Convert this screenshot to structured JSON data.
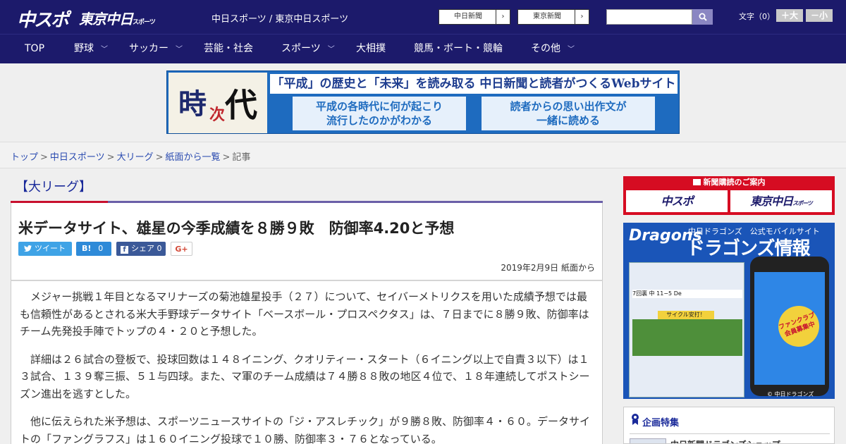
{
  "header": {
    "logo_main": "中スポ",
    "logo_tokyo": "東京中日",
    "logo_tokyo_small": "スポーツ",
    "site_title": "中日スポーツ / 東京中日スポーツ",
    "chunichi_link": "中日新聞",
    "tokyo_link": "東京新聞",
    "arrow": "›",
    "fontsize_label": "文字（0）",
    "font_up": "＋大",
    "font_down": "－小",
    "search_placeholder": ""
  },
  "nav": {
    "items": [
      {
        "label": "TOP",
        "chevron": false
      },
      {
        "label": "野球",
        "chevron": true
      },
      {
        "label": "サッカー",
        "chevron": true
      },
      {
        "label": "芸能・社会",
        "chevron": false
      },
      {
        "label": "スポーツ",
        "chevron": true
      },
      {
        "label": "大相撲",
        "chevron": false
      },
      {
        "label": "競馬・ボート・競輪",
        "chevron": false
      },
      {
        "label": "その他",
        "chevron": true
      }
    ],
    "chevron_glyph": "﹀"
  },
  "banner": {
    "logo_chars": [
      "時",
      "次",
      "代"
    ],
    "headline": "「平成」の歴史と「未来」を読み取る 中日新聞と読者がつくるWebサイト",
    "left_box": [
      "平成の各時代に何が起こり",
      "流行したのかがわかる"
    ],
    "right_box": [
      "読者からの思い出作文が",
      "一緒に読める"
    ],
    "colors": {
      "blue": "#1e6bbf",
      "red": "#c0272d"
    }
  },
  "breadcrumb": {
    "links": [
      "トップ",
      "中日スポーツ",
      "大リーグ",
      "紙面から一覧"
    ],
    "current": "記事",
    "separator": ">"
  },
  "article": {
    "category": "【大リーグ】",
    "title": "米データサイト、雄星の今季成績を８勝９敗　防御率4.20と予想",
    "share": {
      "twitter": "ツイート",
      "hatena": "B!",
      "hatena_count": "0",
      "facebook": "シェア",
      "facebook_count": "0",
      "gplus": "G+"
    },
    "date": "2019年2月9日 紙面から",
    "paragraphs": [
      "メジャー挑戦１年目となるマリナーズの菊池雄星投手（２７）について、セイバーメトリクスを用いた成績予想では最も信頼性があるとされる米大手野球データサイト「ベースボール・プロスペクタス」は、７日までに８勝９敗、防御率はチーム先発投手陣でトップの４・２０と予想した。",
      "詳細は２６試合の登板で、投球回数は１４８イニング、クオリティー・スタート（６イニング以上で自責３以下）は１３試合、１３９奪三振、５１与四球。また、マ軍のチーム成績は７４勝８８敗の地区４位で、１８年連続してポストシーズン進出を逃すとした。",
      "他に伝えられた米予想は、スポーツニュースサイトの「ジ・アスレチック」が９勝８敗、防御率４・６０。データサイトの「ファングラフス」は１６０イニング投球で１０勝、防御率３・７６となっている。"
    ]
  },
  "sidebar": {
    "subscribe_head": "新聞購読のご案内",
    "subscribe_left": "中スポ",
    "subscribe_right": "東京中日",
    "subscribe_right_small": "スポーツ",
    "ad": {
      "logo": "Dragons",
      "sub": "中日ドラゴンズ　公式モバイルサイト",
      "title": "ドラゴンズ情報",
      "score": "7回裏 中 11−5 De",
      "cycle": "サイクル安打！",
      "badge": "ファンクラブ 会員募集中",
      "copyright": "© 中日ドラゴンズ"
    },
    "feature_title": "企画特集",
    "feature_item": "中日新聞ドラゴンズショップ"
  }
}
